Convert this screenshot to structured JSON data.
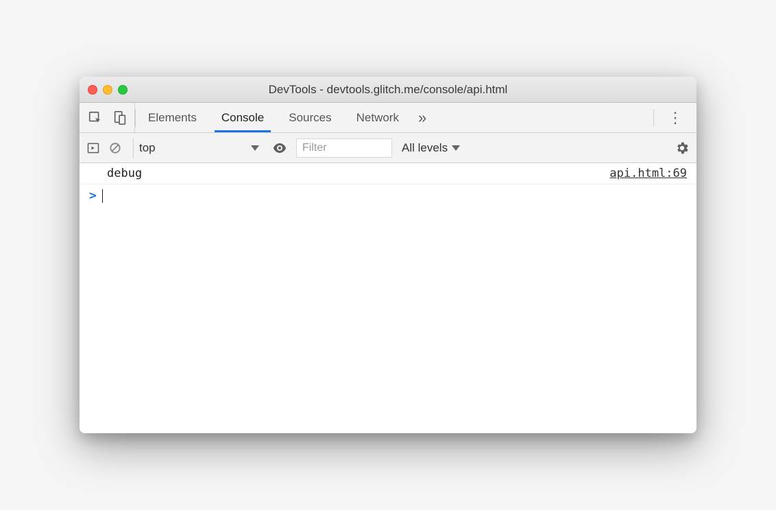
{
  "window": {
    "title": "DevTools - devtools.glitch.me/console/api.html"
  },
  "tabs": {
    "items": [
      "Elements",
      "Console",
      "Sources",
      "Network"
    ],
    "active": "Console"
  },
  "toolbar": {
    "context": "top",
    "filter_placeholder": "Filter",
    "filter_value": "",
    "levels": "All levels"
  },
  "console": {
    "rows": [
      {
        "message": "debug",
        "source": "api.html:69"
      }
    ],
    "prompt": ">"
  }
}
